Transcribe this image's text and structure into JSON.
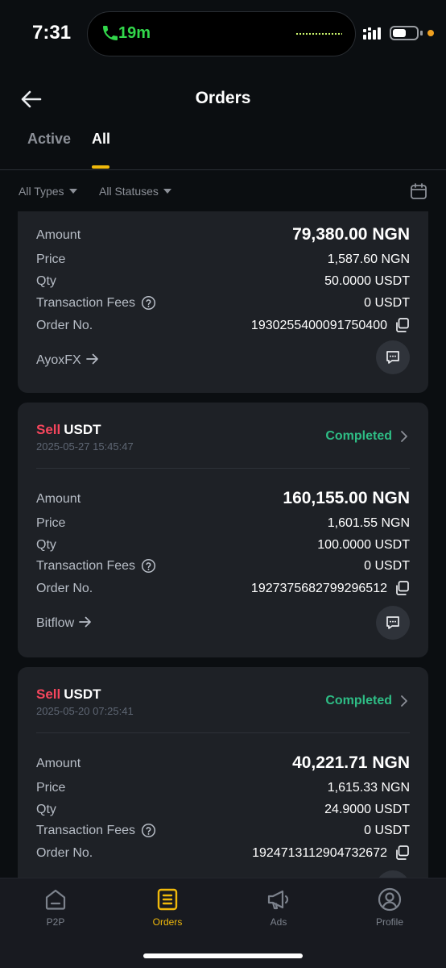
{
  "status_bar": {
    "time": "7:31",
    "call_timer": "19m"
  },
  "header": {
    "title": "Orders",
    "back_icon": "back-arrow-icon"
  },
  "tabs": [
    {
      "label": "Active"
    },
    {
      "label": "All",
      "active": true
    }
  ],
  "filters": {
    "types": "All Types",
    "statuses": "All Statuses",
    "calendar_icon": "calendar-icon"
  },
  "labels": {
    "amount": "Amount",
    "price": "Price",
    "qty": "Qty",
    "fees": "Transaction Fees",
    "order_no": "Order No."
  },
  "orders": [
    {
      "side": "",
      "asset": "",
      "date": "",
      "status": "",
      "amount": "79,380.00 NGN",
      "price": "1,587.60 NGN",
      "qty": "50.0000 USDT",
      "fees": "0 USDT",
      "order_no": "1930255400091750400",
      "merchant": "AyoxFX"
    },
    {
      "side": "Sell",
      "asset": "USDT",
      "date": "2025-05-27 15:45:47",
      "status": "Completed",
      "amount": "160,155.00 NGN",
      "price": "1,601.55 NGN",
      "qty": "100.0000 USDT",
      "fees": "0 USDT",
      "order_no": "1927375682799296512",
      "merchant": "Bitflow"
    },
    {
      "side": "Sell",
      "asset": "USDT",
      "date": "2025-05-20 07:25:41",
      "status": "Completed",
      "amount": "40,221.71 NGN",
      "price": "1,615.33 NGN",
      "qty": "24.9000 USDT",
      "fees": "0 USDT",
      "order_no": "1924713112904732672",
      "merchant": ""
    }
  ],
  "nav": [
    {
      "label": "P2P",
      "icon": "p2p-icon"
    },
    {
      "label": "Orders",
      "icon": "orders-icon",
      "active": true
    },
    {
      "label": "Ads",
      "icon": "megaphone-icon"
    },
    {
      "label": "Profile",
      "icon": "profile-icon"
    }
  ],
  "colors": {
    "sell": "#f6465d",
    "completed": "#2ebd85",
    "accent": "#f0b90b",
    "background": "#0b0e11",
    "card": "#1e2126"
  }
}
